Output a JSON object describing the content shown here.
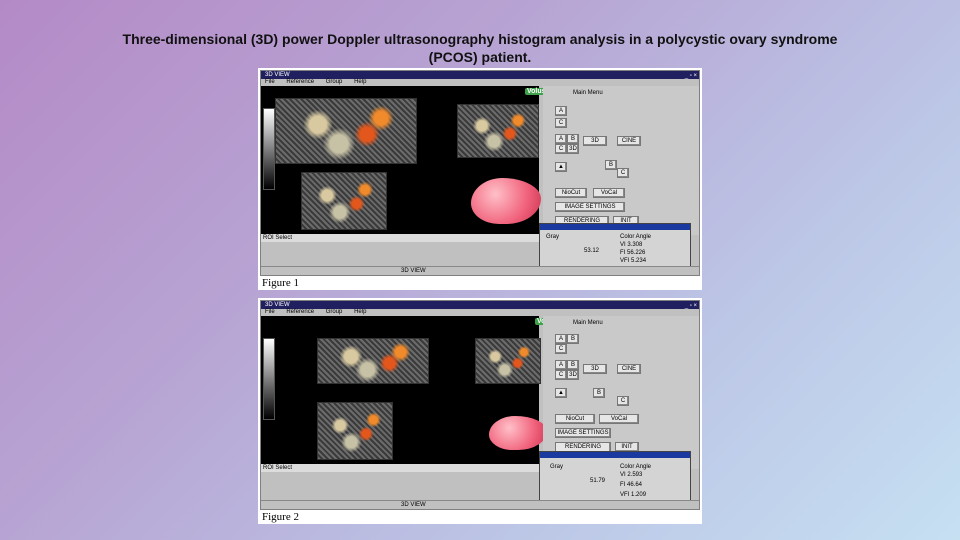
{
  "caption": "Three-dimensional (3D) power Doppler ultrasonography histogram analysis in a polycystic ovary syndrome (PCOS) patient.",
  "figures": [
    {
      "label": "Figure 1",
      "window_title": "3D VIEW",
      "menu": [
        "File",
        "Reference",
        "Group",
        "Help"
      ],
      "main_menu": "Main Menu",
      "buttons": {
        "a": "A",
        "b": "B",
        "c": "C",
        "three_d": "3D",
        "d3": "3D",
        "cine": "CINE",
        "niocut": "NioCut",
        "vocal": "VoCal",
        "image_settings": "IMAGE SETTINGS",
        "rendering_mode": "RENDERING MODE",
        "init": "INIT"
      },
      "roi": "ROI Select",
      "histogram": {
        "gray_label": "Gray",
        "gray_value": "53.12",
        "color_label": "Color Angle",
        "vi": "3.308",
        "fi": "56.226",
        "vfi": "5.234"
      },
      "logo": "Voluson",
      "taskbar": "3D VIEW"
    },
    {
      "label": "Figure 2",
      "window_title": "3D VIEW",
      "menu": [
        "File",
        "Reference",
        "Group",
        "Help"
      ],
      "main_menu": "Main Menu",
      "buttons": {
        "a": "A",
        "b": "B",
        "c": "C",
        "three_d": "3D",
        "d3": "3D",
        "cine": "CINE",
        "niocut": "NioCut",
        "vocal": "VoCal",
        "image_settings": "IMAGE SETTINGS",
        "rendering_mode": "RENDERING MODE",
        "init": "INIT"
      },
      "roi": "ROI Select",
      "histogram": {
        "gray_label": "Gray",
        "gray_value": "51.79",
        "color_label": "Color Angle",
        "vi": "2.593",
        "fi": "46.64",
        "vfi": "1.209"
      },
      "logo": "Voluson",
      "taskbar": "3D VIEW"
    }
  ]
}
